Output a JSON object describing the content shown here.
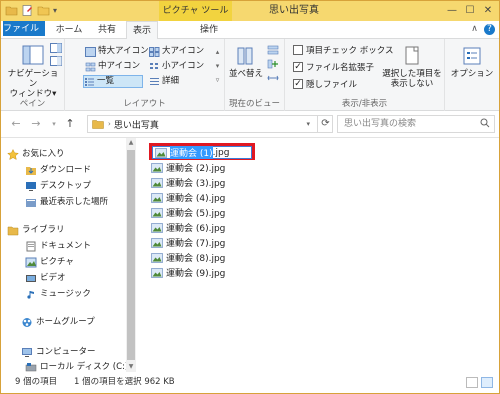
{
  "window": {
    "title": "思い出写真",
    "context_tab_group": "ピクチャ ツール",
    "controls": [
      "minimize-icon",
      "maximize-icon",
      "close-icon"
    ]
  },
  "tabs": {
    "file": "ファイル",
    "home": "ホーム",
    "share": "共有",
    "view": "表示",
    "manage": "操作"
  },
  "ribbon": {
    "pane": {
      "nav_pane_line1": "ナビゲーション",
      "nav_pane_line2": "ウィンドウ▾",
      "label": "ペイン"
    },
    "layout": {
      "items": [
        "特大アイコン",
        "大アイコン",
        "中アイコン",
        "小アイコン",
        "一覧",
        "詳細"
      ],
      "selected": "一覧",
      "label": "レイアウト"
    },
    "current_view": {
      "sort_by": "並べ替え",
      "label": "現在のビュー"
    },
    "show_hide": {
      "item_checkboxes": "項目チェック ボックス",
      "item_checkboxes_checked": false,
      "file_extensions": "ファイル名拡張子",
      "file_extensions_checked": true,
      "hidden_items": "隠しファイル",
      "hidden_items_checked": true,
      "hide_selected_line1": "選択した項目を",
      "hide_selected_line2": "表示しない",
      "label": "表示/非表示"
    },
    "options": {
      "label": "オプション"
    }
  },
  "address_bar": {
    "path": "思い出写真",
    "search_placeholder": "思い出写真の検索"
  },
  "nav_pane": {
    "favorites": "お気に入り",
    "downloads": "ダウンロード",
    "desktop": "デスクトップ",
    "recent": "最近表示した場所",
    "libraries": "ライブラリ",
    "documents": "ドキュメント",
    "pictures": "ピクチャ",
    "videos": "ビデオ",
    "music": "ミュージック",
    "homegroup": "ホームグループ",
    "computer": "コンピューター",
    "local_disk": "ローカル ディスク (C:)"
  },
  "files": {
    "renaming": {
      "name_selected": "運動会 (1)",
      "extension": ".jpg"
    },
    "items": [
      "運動会 (2).jpg",
      "運動会 (3).jpg",
      "運動会 (4).jpg",
      "運動会 (5).jpg",
      "運動会 (6).jpg",
      "運動会 (7).jpg",
      "運動会 (8).jpg",
      "運動会 (9).jpg"
    ]
  },
  "status": {
    "item_count": "9 個の項目",
    "selection": "1 個の項目を選択 962 KB"
  },
  "colors": {
    "title_bar": "#f6d86f",
    "file_tab": "#1979ca",
    "highlight_box": "#e01822",
    "selection": "#3399ff"
  }
}
